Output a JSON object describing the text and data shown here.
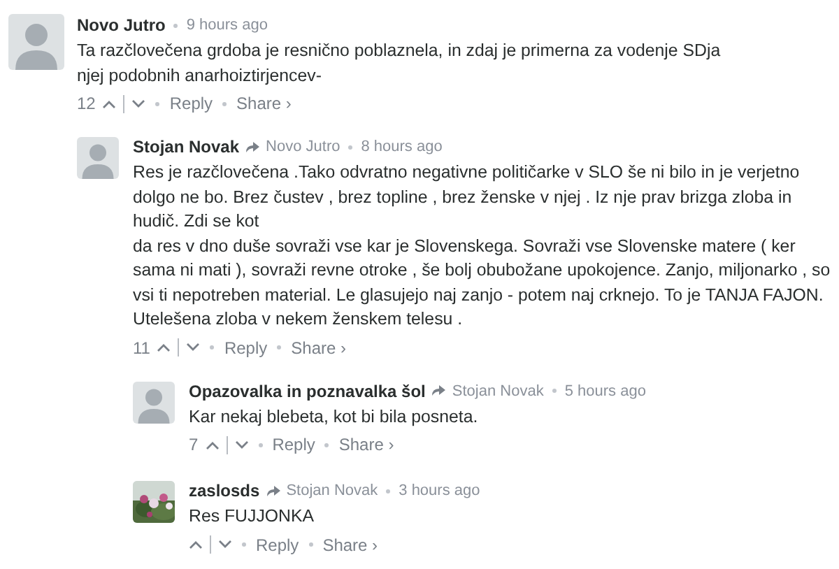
{
  "comments": [
    {
      "author": "Novo Jutro",
      "time": "9 hours ago",
      "text": "Ta razčlovečena grdoba je resnično poblaznela, in zdaj je primerna za vodenje SDja\nnjej podobnih anarhoiztirjencev-",
      "votes": "12",
      "kind": "placeholder",
      "actions": [
        "Reply",
        "Share ›"
      ],
      "children": [
        {
          "author": "Stojan Novak",
          "reply_to": "Novo Jutro",
          "time": "8 hours ago",
          "text": "Res je razčlovečena .Tako odvratno negativne političarke v SLO še ni bilo in je verjetno dolgo ne bo. Brez čustev , brez topline , brez ženske v njej . Iz nje prav brizga zloba in hudič. Zdi se kot\nda res v dno duše sovraži vse kar je Slovenskega. Sovraži vse Slovenske matere ( ker sama ni mati ), sovraži revne otroke , še bolj obubožane upokojence. Zanjo, miljonarko , so vsi ti nepotreben material. Le glasujejo naj zanjo - potem naj crknejo. To je TANJA FAJON. Utelešena zloba v nekem ženskem telesu .",
          "votes": "11",
          "kind": "placeholder",
          "actions": [
            "Reply",
            "Share ›"
          ],
          "children": [
            {
              "author": "Opazovalka in poznavalka šol",
              "reply_to": "Stojan Novak",
              "time": "5 hours ago",
              "text": "Kar nekaj blebeta, kot bi bila posneta.",
              "votes": "7",
              "kind": "placeholder",
              "actions": [
                "Reply",
                "Share ›"
              ]
            },
            {
              "author": "zaslosds",
              "reply_to": "Stojan Novak",
              "time": "3 hours ago",
              "text": "Res FUJJONKA",
              "kind": "picture",
              "actions": [
                "Reply",
                "Share ›"
              ]
            }
          ]
        }
      ]
    }
  ]
}
